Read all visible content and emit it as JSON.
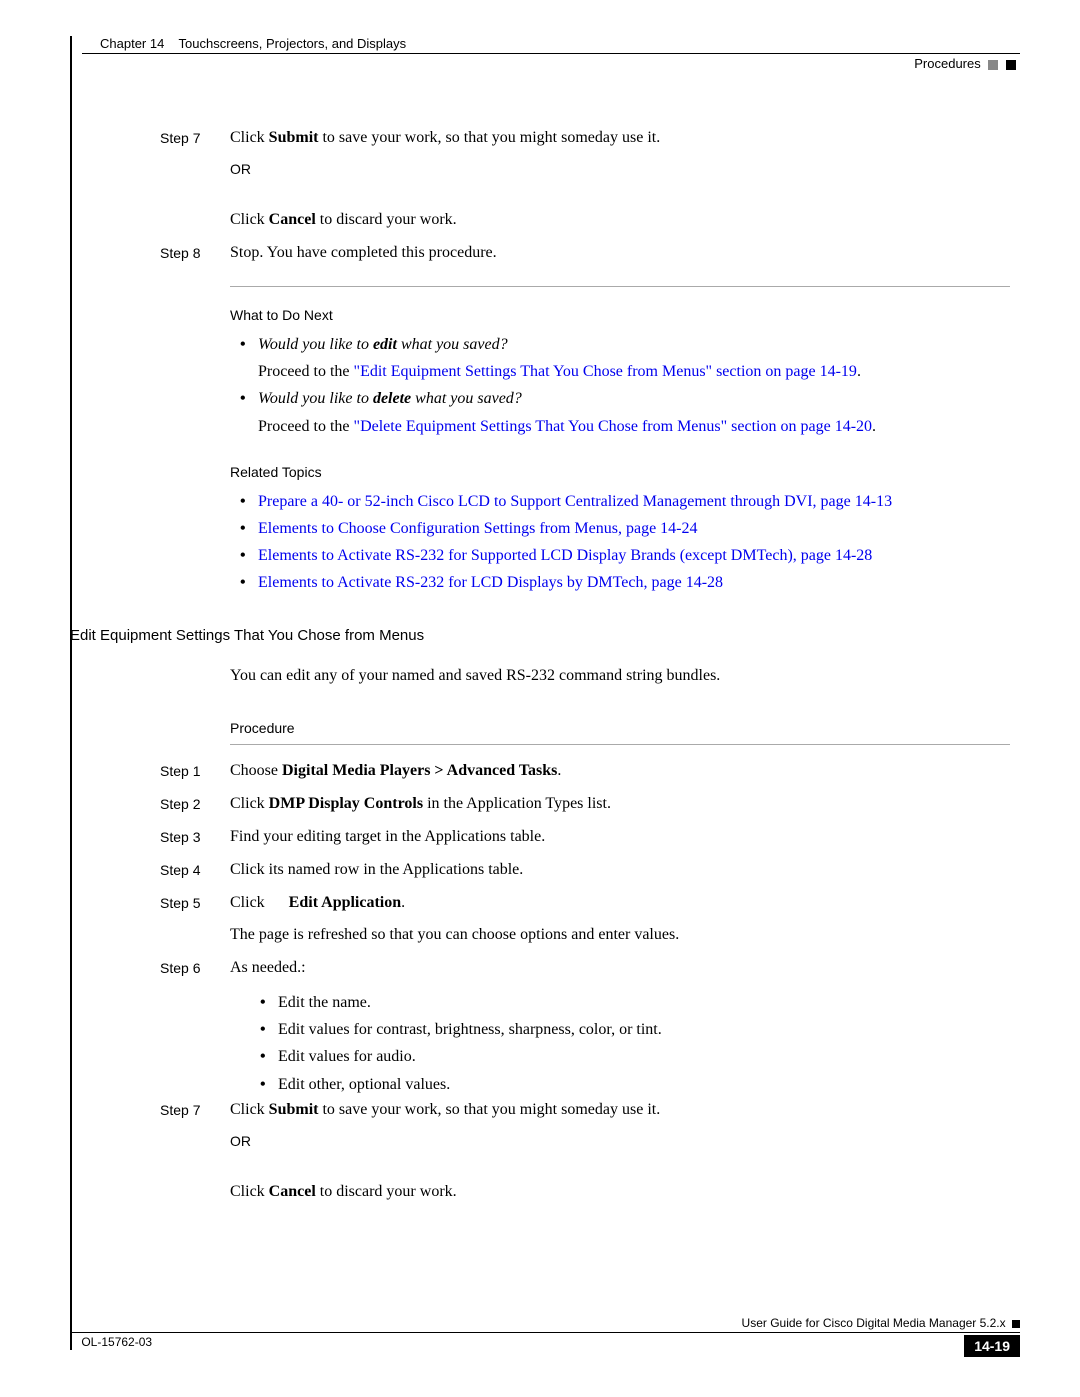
{
  "header": {
    "chapter": "Chapter 14",
    "chapter_title": "Touchscreens, Projectors, and Displays",
    "right_label": "Procedures"
  },
  "section1": {
    "step7_label": "Step 7",
    "step7_a": "Click ",
    "step7_b": "Submit",
    "step7_c": " to save your work, so that you might someday use it.",
    "or": "OR",
    "cancel_a": "Click ",
    "cancel_b": "Cancel",
    "cancel_c": " to discard your work.",
    "step8_label": "Step 8",
    "step8_text": "Stop. You have completed this procedure."
  },
  "what_next": {
    "heading": "What to Do Next",
    "b1_q_a": "Would you like to ",
    "b1_q_b": "edit",
    "b1_q_c": " what you saved?",
    "b1_proceed": "Proceed to the ",
    "b1_link": "\"Edit Equipment Settings That You Chose from Menus\" section on page 14-19",
    "b1_dot": ".",
    "b2_q_a": "Would you like to ",
    "b2_q_b": "delete",
    "b2_q_c": " what you saved?",
    "b2_proceed": "Proceed to the ",
    "b2_link": "\"Delete Equipment Settings That You Chose from Menus\" section on page 14-20",
    "b2_dot": "."
  },
  "related": {
    "heading": "Related Topics",
    "link1": "Prepare a 40- or 52-inch Cisco LCD to Support Centralized Management through DVI, page 14-13",
    "link2": "Elements to Choose Configuration Settings from Menus, page 14-24",
    "link3": "Elements to Activate RS-232 for Supported LCD Display Brands (except DMTech), page 14-28",
    "link4": "Elements to Activate RS-232 for LCD Displays by DMTech, page 14-28"
  },
  "section_heading": "Edit Equipment Settings That You Chose from Menus",
  "intro": "You can edit any of your named and saved RS-232 command string bundles.",
  "procedure_label": "Procedure",
  "proc": {
    "s1_label": "Step 1",
    "s1_a": "Choose ",
    "s1_b": "Digital Media Players > Advanced Tasks",
    "s1_c": ".",
    "s2_label": "Step 2",
    "s2_a": "Click ",
    "s2_b": "DMP Display Controls",
    "s2_c": " in the Application Types list.",
    "s3_label": "Step 3",
    "s3": "Find your editing target in the Applications table.",
    "s4_label": "Step 4",
    "s4": "Click its named row in the Applications table.",
    "s5_label": "Step 5",
    "s5_a": "Click ",
    "s5_b": "Edit Application",
    "s5_c": ".",
    "s5_note": "The page is refreshed so that you can choose options and enter values.",
    "s6_label": "Step 6",
    "s6": "As needed.:",
    "s6_b1": "Edit the name.",
    "s6_b2": "Edit values for contrast, brightness, sharpness, color, or tint.",
    "s6_b3": "Edit values for audio.",
    "s6_b4": "Edit other, optional values.",
    "s7_label": "Step 7",
    "s7_a": "Click ",
    "s7_b": "Submit",
    "s7_c": " to save your work, so that you might someday use it.",
    "or": "OR",
    "cancel_a": "Click ",
    "cancel_b": "Cancel",
    "cancel_c": " to discard your work."
  },
  "footer": {
    "guide": "User Guide for Cisco Digital Media Manager 5.2.x",
    "doc_id": "OL-15762-03",
    "page": "14-19"
  }
}
